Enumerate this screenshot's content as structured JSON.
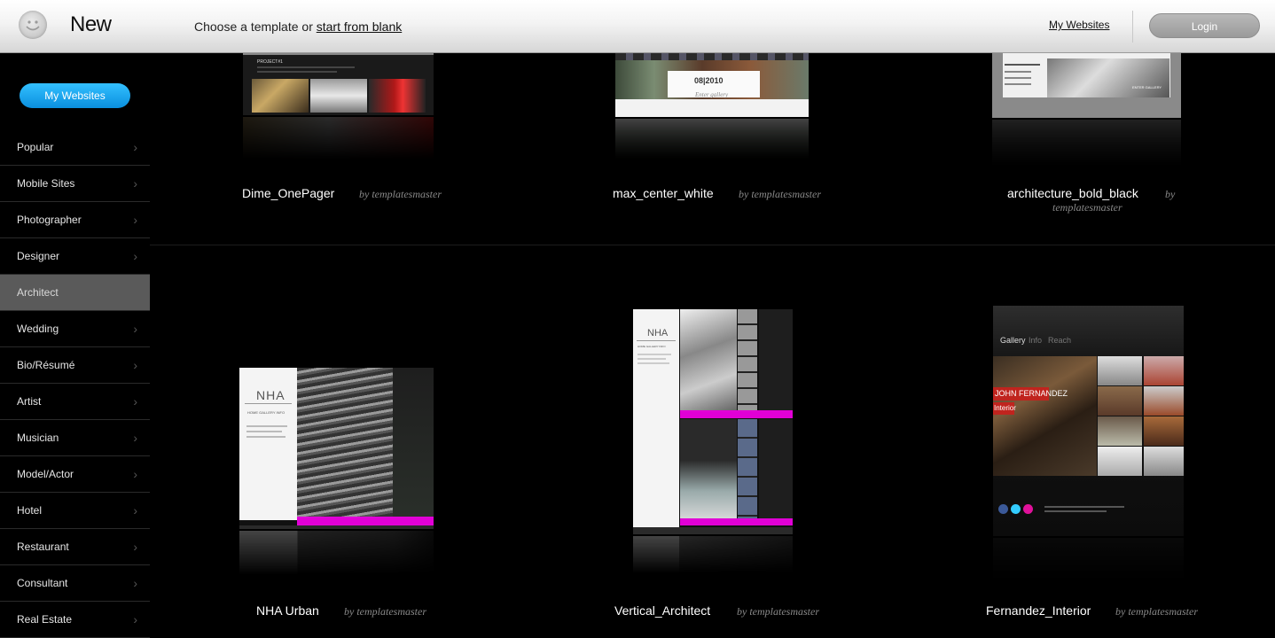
{
  "header": {
    "app_title": "New",
    "subtitle_prefix": "Choose a template or ",
    "subtitle_link": "start from blank",
    "my_websites": "My Websites",
    "login": "Login"
  },
  "sidebar": {
    "my_websites_button": "My Websites",
    "items": [
      {
        "label": "Popular"
      },
      {
        "label": "Mobile Sites"
      },
      {
        "label": "Photographer"
      },
      {
        "label": "Designer"
      },
      {
        "label": "Architect",
        "active": true
      },
      {
        "label": "Wedding"
      },
      {
        "label": "Bio/Résumé"
      },
      {
        "label": "Artist"
      },
      {
        "label": "Musician"
      },
      {
        "label": "Model/Actor"
      },
      {
        "label": "Hotel"
      },
      {
        "label": "Restaurant"
      },
      {
        "label": "Consultant"
      },
      {
        "label": "Real Estate"
      }
    ],
    "chevron": "›"
  },
  "templates": [
    {
      "name": "Dime_OnePager",
      "author": "by templatesmaster",
      "thumb_text": "PROJECT#1"
    },
    {
      "name": "max_center_white",
      "author": "by templatesmaster",
      "thumb_text": "08|2010",
      "thumb_sub": "Enter gallery"
    },
    {
      "name": "architecture_bold_black",
      "author_by": "by",
      "author_name": "templatesmaster",
      "thumb_text": "ENTER GALLERY"
    },
    {
      "name": "NHA Urban",
      "author": "by templatesmaster",
      "thumb_text": "NHA",
      "thumb_nav": "HOME   GALLERY   INFO"
    },
    {
      "name": "Vertical_Architect",
      "author": "by templatesmaster",
      "thumb_text": "NHA",
      "thumb_nav": "HOME GALLERY INFO"
    },
    {
      "name": "Fernandez_Interior",
      "author": "by templatesmaster",
      "thumb_nav": [
        "Gallery",
        "Info",
        "Reach"
      ],
      "thumb_title1": "JOHN FERNANDEZ",
      "thumb_title2": "Interior"
    }
  ],
  "colors": {
    "accent_blue": "#0a8fde",
    "magenta": "#e100d6",
    "active_item": "#5a5a5a"
  }
}
